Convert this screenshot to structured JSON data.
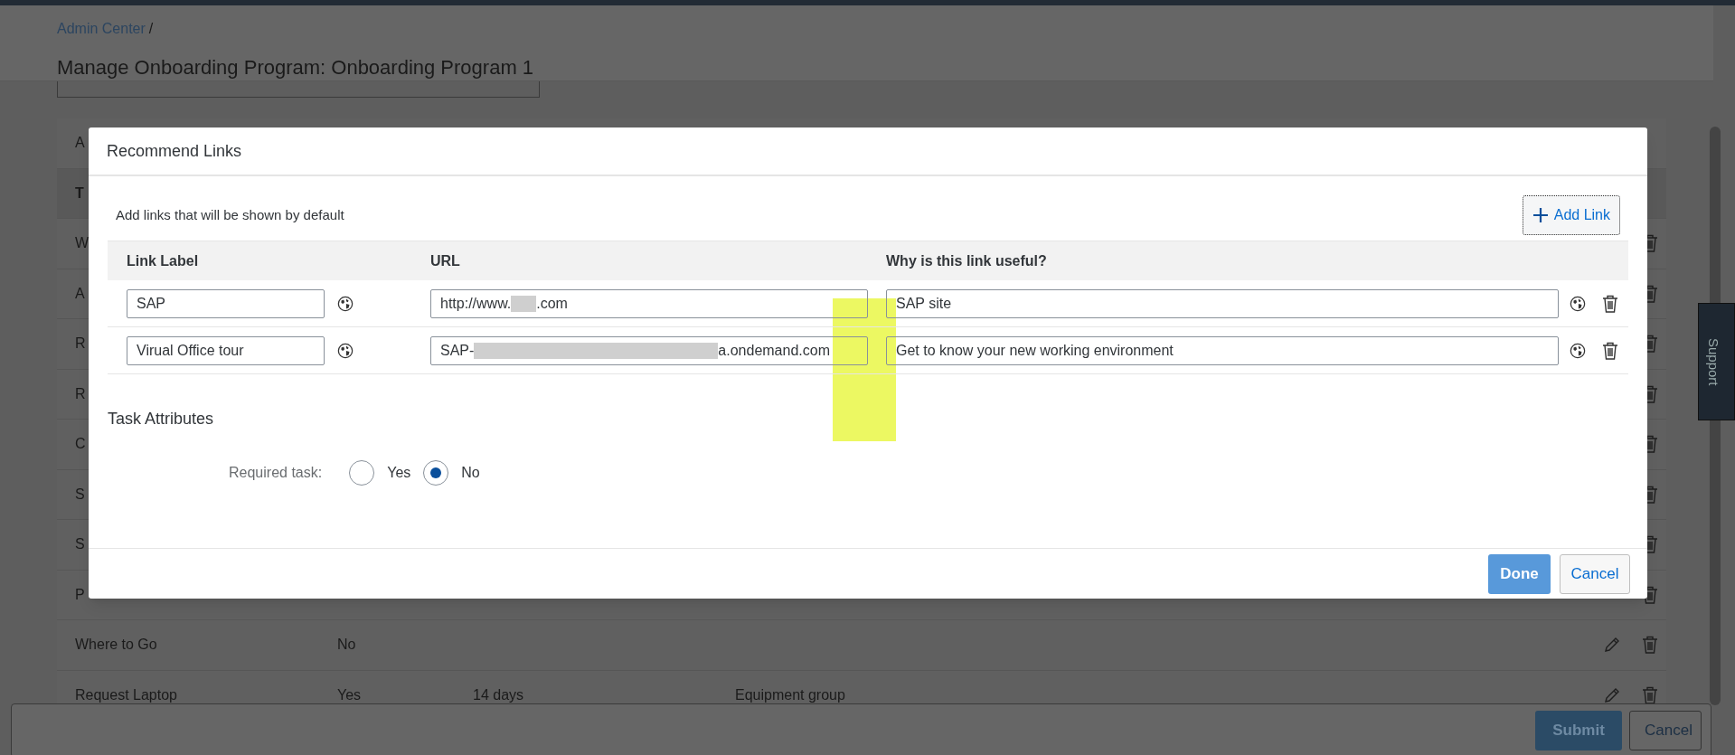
{
  "breadcrumb": {
    "link": "Admin Center",
    "separator": "/"
  },
  "page_title": "Manage Onboarding Program: Onboarding Program 1",
  "background_table": {
    "rows": [
      {
        "kind": "row",
        "cells": [
          "A"
        ],
        "show_delete": false
      },
      {
        "kind": "header",
        "cells": [
          "T"
        ],
        "show_delete": false
      },
      {
        "kind": "row",
        "cells": [
          "W"
        ],
        "show_delete": true
      },
      {
        "kind": "row",
        "cells": [
          "A"
        ],
        "show_delete": true
      },
      {
        "kind": "row",
        "cells": [
          "R"
        ],
        "show_delete": true
      },
      {
        "kind": "row",
        "cells": [
          "R"
        ],
        "show_delete": true
      },
      {
        "kind": "row",
        "cells": [
          "C"
        ],
        "show_delete": true
      },
      {
        "kind": "row",
        "cells": [
          "S"
        ],
        "show_delete": true
      },
      {
        "kind": "row",
        "cells": [
          "S"
        ],
        "show_delete": true
      },
      {
        "kind": "row",
        "cells": [
          "P"
        ],
        "show_delete": true
      },
      {
        "kind": "row",
        "cells": [
          "Where to Go",
          "No"
        ],
        "show_edit": true,
        "show_delete": true
      },
      {
        "kind": "row",
        "cells": [
          "Request Laptop",
          "Yes",
          "14 days",
          "Equipment group"
        ],
        "show_edit": true,
        "show_delete": true
      }
    ]
  },
  "footer_buttons": [
    {
      "label": "Submit",
      "kind": "primary"
    },
    {
      "label": "Cancel",
      "kind": "secondary"
    }
  ],
  "support_tab": "Support",
  "dialog": {
    "title": "Recommend Links",
    "instruction": "Add links that will be shown by default",
    "add_button": "Add Link",
    "columns": [
      "Link Label",
      "URL",
      "Why is this link useful?"
    ],
    "rows": [
      {
        "label": "SAP",
        "url": [
          {
            "kind": "text",
            "text": "http://www."
          },
          {
            "kind": "short_redaction"
          },
          {
            "kind": "text",
            "text": ".com"
          }
        ],
        "why": "SAP site"
      },
      {
        "label": "Virual Office tour",
        "url": [
          {
            "kind": "text",
            "text": "SAP-"
          },
          {
            "kind": "long_redaction"
          },
          {
            "kind": "text",
            "text": "a.ondemand.com"
          }
        ],
        "why": "Get to know your new working environment"
      }
    ],
    "section_title": "Task Attributes",
    "required_task": {
      "label": "Required task:",
      "options": [
        {
          "label": "Yes",
          "selected": false
        },
        {
          "label": "No",
          "selected": true
        }
      ]
    },
    "buttons": [
      {
        "label": "Done",
        "kind": "primary"
      },
      {
        "label": "Cancel",
        "kind": "secondary"
      }
    ]
  },
  "annotation": {
    "kind": "highlight"
  }
}
